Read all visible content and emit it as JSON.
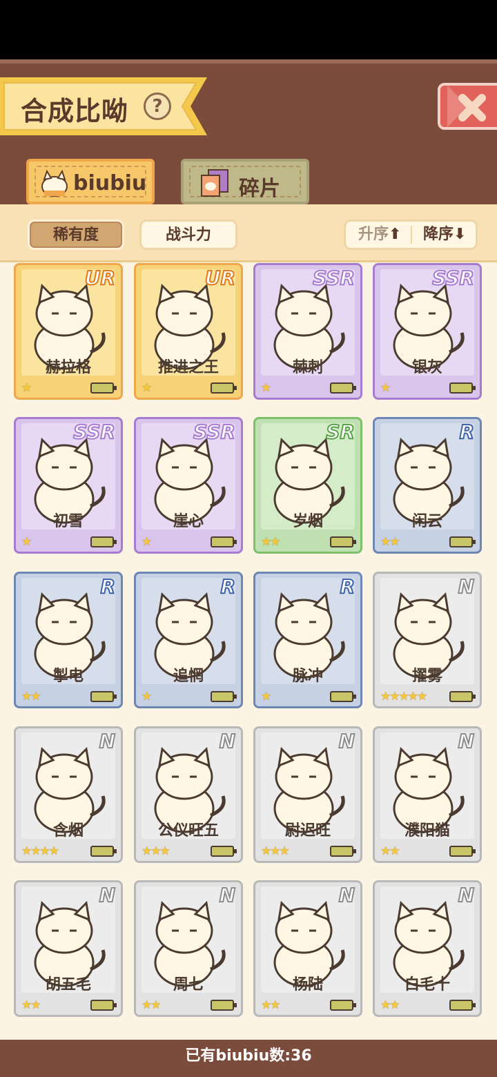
{
  "header": {
    "title": "合成比呦",
    "help_icon": "?",
    "close_icon": "close-x"
  },
  "tabs": [
    {
      "label": "biubiu",
      "icon": "cat-icon",
      "active": true
    },
    {
      "label": "碎片",
      "icon": "fragment-icon",
      "active": false
    }
  ],
  "sort": {
    "rarity": "稀有度",
    "power": "战斗力",
    "ascending": "升序",
    "descending": "降序"
  },
  "cards": [
    {
      "name": "赫拉格",
      "rarity": "UR",
      "stars": 1
    },
    {
      "name": "推进之王",
      "rarity": "UR",
      "stars": 1
    },
    {
      "name": "棘刺",
      "rarity": "SSR",
      "stars": 1
    },
    {
      "name": "银灰",
      "rarity": "SSR",
      "stars": 1
    },
    {
      "name": "初雪",
      "rarity": "SSR",
      "stars": 1
    },
    {
      "name": "崖心",
      "rarity": "SSR",
      "stars": 1
    },
    {
      "name": "岁烟",
      "rarity": "SR",
      "stars": 2
    },
    {
      "name": "闲云",
      "rarity": "R",
      "stars": 2
    },
    {
      "name": "掣电",
      "rarity": "R",
      "stars": 2
    },
    {
      "name": "追惘",
      "rarity": "R",
      "stars": 1
    },
    {
      "name": "脉冲",
      "rarity": "R",
      "stars": 1
    },
    {
      "name": "擢雾",
      "rarity": "N",
      "stars": 5
    },
    {
      "name": "含烟",
      "rarity": "N",
      "stars": 4
    },
    {
      "name": "公仪旺五",
      "rarity": "N",
      "stars": 3
    },
    {
      "name": "尉迟旺",
      "rarity": "N",
      "stars": 3
    },
    {
      "name": "濮阳猫",
      "rarity": "N",
      "stars": 2
    },
    {
      "name": "胡五毛",
      "rarity": "N",
      "stars": 2
    },
    {
      "name": "周七",
      "rarity": "N",
      "stars": 2
    },
    {
      "name": "杨陆",
      "rarity": "N",
      "stars": 2
    },
    {
      "name": "白毛十",
      "rarity": "N",
      "stars": 2
    }
  ],
  "footer": {
    "count_text": "已有biubiu数:36"
  }
}
